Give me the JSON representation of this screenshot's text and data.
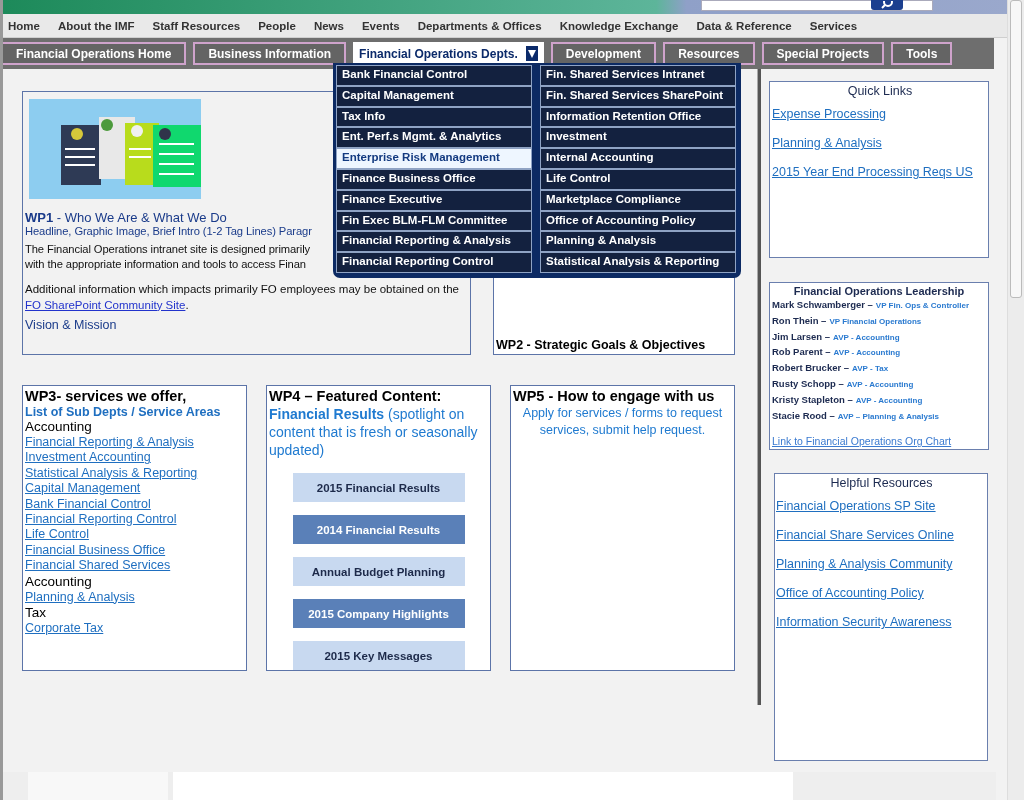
{
  "top_nav": [
    "Home",
    "About the IMF",
    "Staff Resources",
    "People",
    "News",
    "Events",
    "Departments & Offices",
    "Knowledge Exchange",
    "Data & Reference",
    "Services"
  ],
  "sub_nav": [
    {
      "label": "Financial Operations Home",
      "selected": false
    },
    {
      "label": "Business Information",
      "selected": false
    },
    {
      "label": "Financial Operations Depts.",
      "selected": true
    },
    {
      "label": "Development",
      "selected": false
    },
    {
      "label": "Resources",
      "selected": false
    },
    {
      "label": "Special Projects",
      "selected": false
    },
    {
      "label": "Tools",
      "selected": false
    }
  ],
  "dropdown": {
    "columns": [
      [
        {
          "label": "Bank Financial Control",
          "selected": false
        },
        {
          "label": "Capital Management",
          "selected": false
        },
        {
          "label": "Tax Info",
          "selected": false
        },
        {
          "label": "Ent. Perf.s Mgmt. & Analytics",
          "selected": false
        },
        {
          "label": "Enterprise Risk Management",
          "selected": true
        },
        {
          "label": "Finance Business Office",
          "selected": false
        },
        {
          "label": "Finance Executive",
          "selected": false
        },
        {
          "label": "Fin Exec BLM-FLM Committee",
          "selected": false
        },
        {
          "label": "Financial Reporting & Analysis",
          "selected": false
        },
        {
          "label": "Financial Reporting Control",
          "selected": false
        }
      ],
      [
        {
          "label": "Fin. Shared Services Intranet",
          "selected": false
        },
        {
          "label": "Fin. Shared Services SharePoint",
          "selected": false
        },
        {
          "label": "Information Retention Office",
          "selected": false
        },
        {
          "label": "Investment",
          "selected": false
        },
        {
          "label": "Internal Accounting",
          "selected": false
        },
        {
          "label": "Life Control",
          "selected": false
        },
        {
          "label": "Marketplace Compliance",
          "selected": false
        },
        {
          "label": "Office of Accounting Policy",
          "selected": false
        },
        {
          "label": "Planning & Analysis",
          "selected": false
        },
        {
          "label": "Statistical Analysis & Reporting",
          "selected": false
        }
      ]
    ]
  },
  "wp1": {
    "title": "**WP1** - Who We Are & What We Do",
    "headline": "Headline, Graphic Image, Brief Intro (1-2 Tag Lines) Paragr",
    "intro_lines": [
      "The Financial Operations intranet site is designed primarily",
      "with the appropriate information and tools to access Finan"
    ],
    "additional": "Additional information which impacts primarily FO employees may be obtained on the",
    "additional_link": "FO SharePoint Community Site",
    "additional_end": ".",
    "vision": "Vision & Mission"
  },
  "wp2": {
    "title": "WP2 - Strategic Goals & Objectives"
  },
  "wp3": {
    "title": "WP3- services we offer,",
    "subtitle": "List of Sub Depts / Service Areas",
    "groups": [
      {
        "heading": "Accounting",
        "links": [
          "Financial Reporting & Analysis",
          "Investment Accounting",
          "Statistical Analysis & Reporting",
          "Capital Management",
          "Bank Financial Control",
          "Financial Reporting Control",
          "Life Control",
          "Financial Business Office",
          "Financial Shared Services"
        ]
      },
      {
        "heading": "Accounting",
        "links": [
          "Planning & Analysis"
        ]
      },
      {
        "heading": "Tax",
        "links": [
          "Corporate Tax"
        ]
      }
    ]
  },
  "wp4": {
    "title": "WP4 – Featured Content:",
    "subtitle": "**Financial Results** (spotlight on content that is fresh or seasonally updated)",
    "buttons": [
      {
        "label": "2015 Financial Results",
        "kind": "light"
      },
      {
        "label": "2014 Financial Results",
        "kind": "dark"
      },
      {
        "label": "Annual Budget Planning",
        "kind": "light"
      },
      {
        "label": "2015 Company Highlights",
        "kind": "dark"
      },
      {
        "label": "2015 Key Messages",
        "kind": "light"
      }
    ]
  },
  "wp5": {
    "title": "WP5 - How to engage with us",
    "text": "Apply for  services / forms to request services, submit help request."
  },
  "quick_links": {
    "title": "Quick Links",
    "links": [
      "Expense Processing",
      "Planning & Analysis",
      "2015 Year End Processing Reqs US"
    ]
  },
  "leadership": {
    "title": "Financial Operations Leadership",
    "people": [
      {
        "name": "Mark Schwamberger –",
        "role": "VP Fin. Ops & Controller"
      },
      {
        "name": "Ron Thein –",
        "role": "VP Financial Operations"
      },
      {
        "name": "Jim Larsen –",
        "role": "AVP - Accounting"
      },
      {
        "name": "Rob Parent –",
        "role": "AVP - Accounting"
      },
      {
        "name": "Robert Brucker –",
        "role": "AVP - Tax"
      },
      {
        "name": "Rusty Schopp –",
        "role": "AVP - Accounting"
      },
      {
        "name": "Kristy Stapleton –",
        "role": "AVP - Accounting"
      },
      {
        "name": "Stacie Rood –",
        "role": "AVP – Planning & Analysis"
      }
    ],
    "link": "Link to Financial Operations Org Chart"
  },
  "helpful_resources": {
    "title": "Helpful Resources",
    "links": [
      "Financial Operations SP Site",
      "Financial Share Services Online",
      "Planning & Analysis Community",
      "Office of Accounting Policy",
      "Information Security Awareness"
    ]
  }
}
